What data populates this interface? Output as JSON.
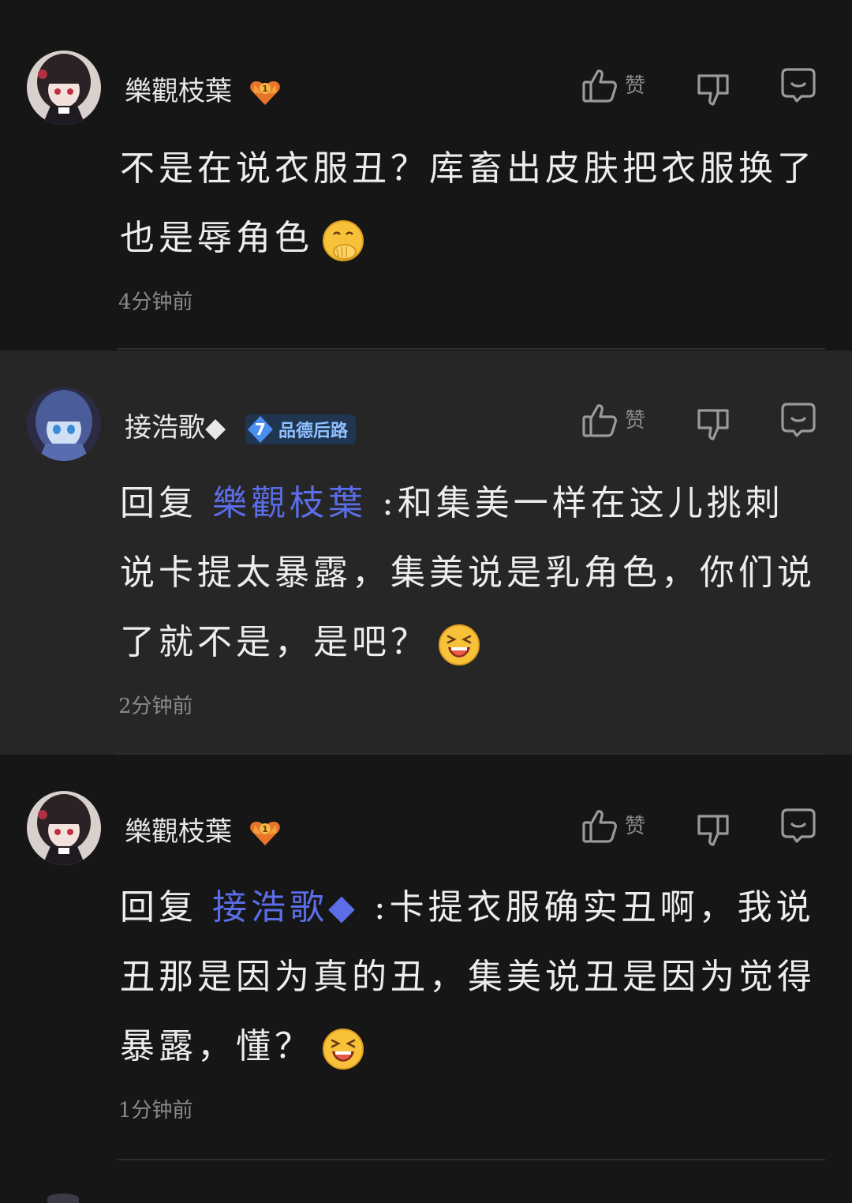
{
  "comments": [
    {
      "username": "樂觀枝葉",
      "like_label": "赞",
      "prefix": "",
      "mention": "",
      "separator": "",
      "text": "不是在说衣服丑？库畜出皮肤把衣服换了也是辱角色",
      "emoji": "hand-over-mouth-emoji",
      "time": "4分钟前"
    },
    {
      "username": "接浩歌◆",
      "badge": {
        "level": "7",
        "label": "品德后路"
      },
      "like_label": "赞",
      "prefix": "回复 ",
      "mention": "樂觀枝葉",
      "separator": "  :",
      "text": "和集美一样在这儿挑刺说卡提太暴露，集美说是乳角色，你们说了就不是，是吧？",
      "emoji": "laughing-emoji",
      "time": "2分钟前"
    },
    {
      "username": "樂觀枝葉",
      "like_label": "赞",
      "prefix": "回复 ",
      "mention": "接浩歌◆",
      "separator": "  :",
      "text": "卡提衣服确实丑啊，我说丑那是因为真的丑，集美说丑是因为觉得暴露，懂？",
      "emoji": "laughing-emoji",
      "time": "1分钟前"
    }
  ],
  "colors": {
    "background": "#161616",
    "highlight_background": "#262626",
    "mention": "#5b6ee8",
    "muted": "#8a8a8a"
  }
}
